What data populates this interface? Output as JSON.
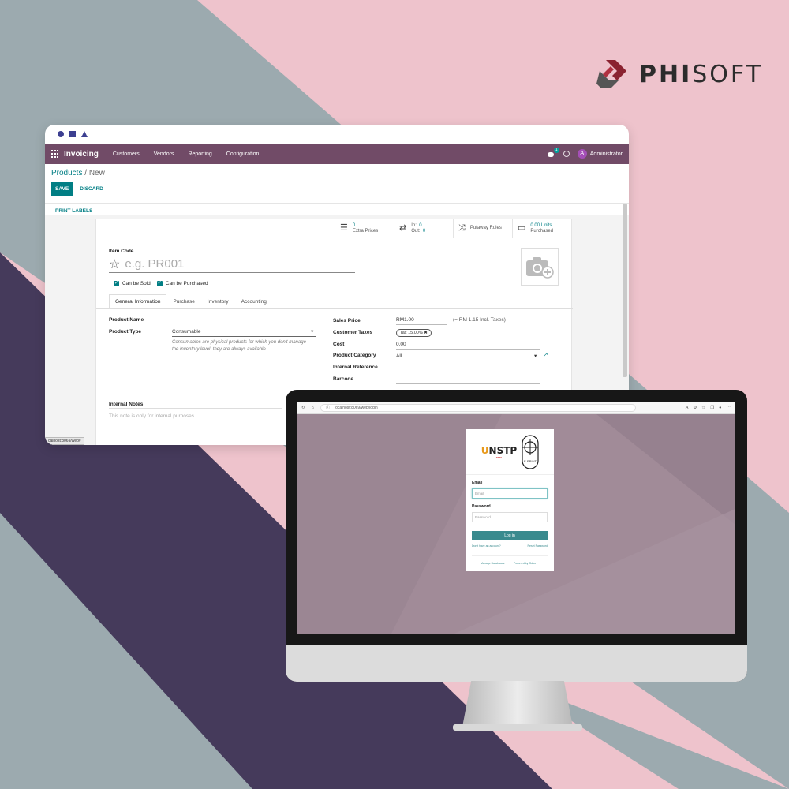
{
  "brand": {
    "phi": "PHI",
    "soft": "SOFT"
  },
  "odoo": {
    "app_title": "Invoicing",
    "menu": [
      "Customers",
      "Vendors",
      "Reporting",
      "Configuration"
    ],
    "chat_count": "1",
    "user_initial": "A",
    "user_name": "Administrator",
    "breadcrumb_parent": "Products",
    "breadcrumb_sep": " / ",
    "breadcrumb_current": "New",
    "save_label": "SAVE",
    "discard_label": "DISCARD",
    "print_labels": "PRINT LABELS",
    "smart": {
      "extra_count": "0",
      "extra_label": "Extra Prices",
      "in_label": "In:",
      "in_val": "0",
      "out_label": "Out:",
      "out_val": "0",
      "putaway": "Putaway Rules",
      "units": "0.00 Units",
      "purchased": "Purchased"
    },
    "item_code_label": "Item Code",
    "name_placeholder": "e.g. PR001",
    "can_be_sold": "Can be Sold",
    "can_be_purchased": "Can be Purchased",
    "tabs": [
      "General Information",
      "Purchase",
      "Inventory",
      "Accounting"
    ],
    "product_name_label": "Product Name",
    "product_type_label": "Product Type",
    "product_type_value": "Consumable",
    "product_type_help": "Consumables are physical products for which you don't manage the inventory level: they are always available.",
    "sales_price_label": "Sales Price",
    "sales_price_value": "RM1.00",
    "incl_taxes": "(= RM 1.15 Incl. Taxes)",
    "customer_taxes_label": "Customer Taxes",
    "tax_tag": "Tax 15.00% ✖",
    "cost_label": "Cost",
    "cost_value": "0.00",
    "product_category_label": "Product Category",
    "product_category_value": "All",
    "internal_ref_label": "Internal Reference",
    "barcode_label": "Barcode",
    "internal_notes_label": "Internal Notes",
    "internal_notes_placeholder": "This note is only for internal purposes.",
    "url_tooltip": "calhost:8069/web#"
  },
  "login": {
    "url": "localhost:8069/web/login",
    "logo_text": "NSTP",
    "logo_u": "U",
    "email_label": "Email",
    "email_placeholder": "Email",
    "password_label": "Password",
    "password_placeholder": "Password",
    "login_button": "Log in",
    "no_account": "Don't have an account?",
    "reset_password": "Reset Password",
    "manage_databases": "Manage Databases",
    "powered_by": "Powered by Odoo",
    "eprint": "E-PRINT"
  },
  "colors": {
    "brand_purple": "#714b67",
    "accent_teal": "#017e84",
    "bg_pink": "#eec3cc",
    "bg_gray": "#9caaaf",
    "bg_navy": "#453a5b"
  }
}
